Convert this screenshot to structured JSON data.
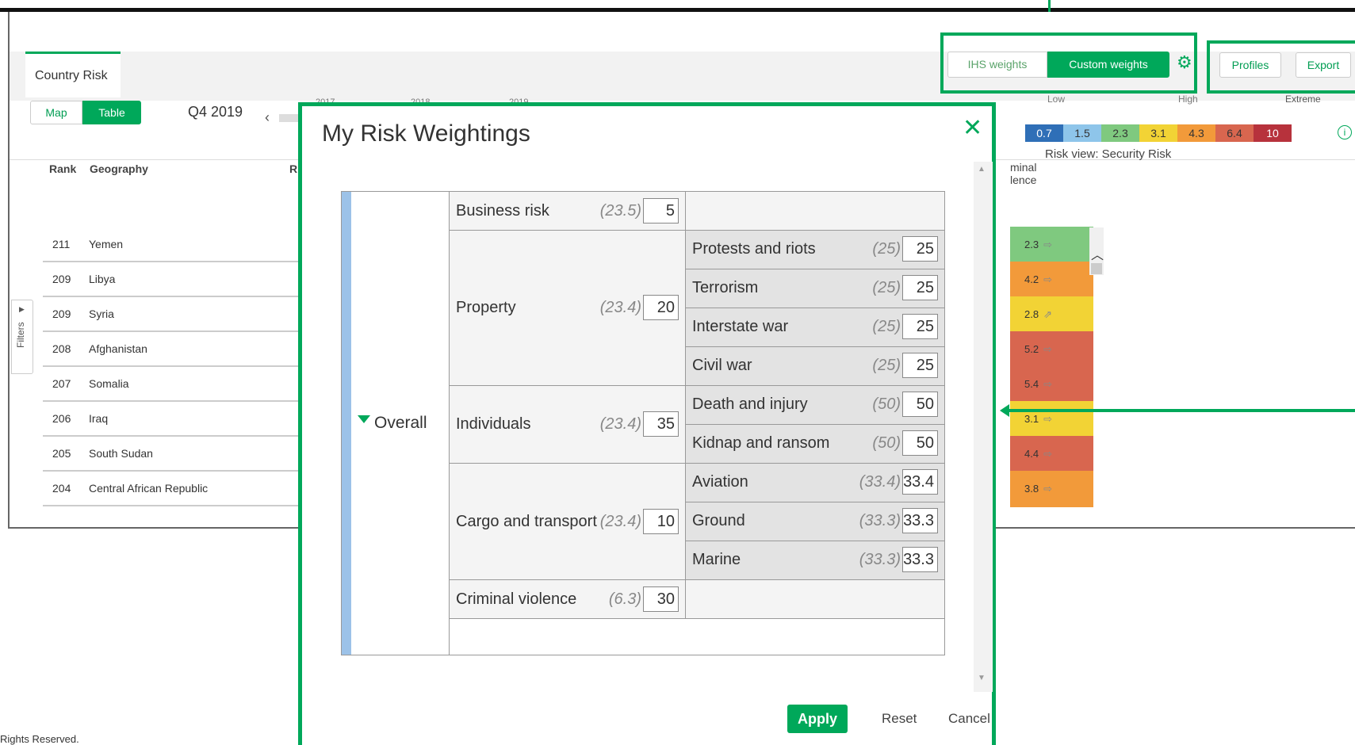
{
  "app": {
    "tab": "Country Risk",
    "view_toggle": [
      "Map",
      "Table"
    ],
    "period": "Q4 2019",
    "years": [
      "2017",
      "2018",
      "2019"
    ],
    "weights_toggle": [
      "IHS weights",
      "Custom weights"
    ],
    "profiles": "Profiles",
    "export": "Export",
    "legend": {
      "labels": [
        "Low",
        "High",
        "Extreme"
      ],
      "values": [
        "0.7",
        "1.5",
        "2.3",
        "3.1",
        "4.3",
        "6.4",
        "10"
      ],
      "colors": [
        "#2f6fb7",
        "#8ec5ea",
        "#7fc97f",
        "#f2d335",
        "#f29a3a",
        "#d8664f",
        "#b7323c"
      ]
    },
    "risk_view": "Risk view: Security Risk",
    "columns": {
      "rank": "Rank",
      "geography": "Geography",
      "extra": "Ri",
      "criminal": "minal\nlence"
    },
    "rows": [
      {
        "rank": "211",
        "geo": "Yemen",
        "score": "2.3",
        "trend": "⇨",
        "color": "#7fc97f"
      },
      {
        "rank": "209",
        "geo": "Libya",
        "score": "4.2",
        "trend": "⇨",
        "color": "#f29a3a"
      },
      {
        "rank": "209",
        "geo": "Syria",
        "score": "2.8",
        "trend": "⇗",
        "color": "#f2d335"
      },
      {
        "rank": "208",
        "geo": "Afghanistan",
        "score": "5.2",
        "trend": "⇨",
        "color": "#d8664f"
      },
      {
        "rank": "207",
        "geo": "Somalia",
        "score": "5.4",
        "trend": "⇨",
        "color": "#d8664f"
      },
      {
        "rank": "206",
        "geo": "Iraq",
        "score": "3.1",
        "trend": "⇨",
        "color": "#f2d335"
      },
      {
        "rank": "205",
        "geo": "South Sudan",
        "score": "4.4",
        "trend": "⇨",
        "color": "#d8664f"
      },
      {
        "rank": "204",
        "geo": "Central African Republic",
        "score": "3.8",
        "trend": "⇨",
        "color": "#f29a3a"
      }
    ],
    "filters": "Filters",
    "footer": "Rights Reserved."
  },
  "modal": {
    "title": "My Risk Weightings",
    "overall": "Overall",
    "categories": [
      {
        "label": "Business risk",
        "default": "(23.5)",
        "value": "5",
        "subs": []
      },
      {
        "label": "Property",
        "default": "(23.4)",
        "value": "20",
        "subs": [
          {
            "label": "Protests and riots",
            "default": "(25)",
            "value": "25"
          },
          {
            "label": "Terrorism",
            "default": "(25)",
            "value": "25"
          },
          {
            "label": "Interstate war",
            "default": "(25)",
            "value": "25"
          },
          {
            "label": "Civil war",
            "default": "(25)",
            "value": "25"
          }
        ]
      },
      {
        "label": "Individuals",
        "default": "(23.4)",
        "value": "35",
        "subs": [
          {
            "label": "Death and injury",
            "default": "(50)",
            "value": "50"
          },
          {
            "label": "Kidnap and ransom",
            "default": "(50)",
            "value": "50"
          }
        ]
      },
      {
        "label": "Cargo and transport",
        "default": "(23.4)",
        "value": "10",
        "subs": [
          {
            "label": "Aviation",
            "default": "(33.4)",
            "value": "33.4"
          },
          {
            "label": "Ground",
            "default": "(33.3)",
            "value": "33.3"
          },
          {
            "label": "Marine",
            "default": "(33.3)",
            "value": "33.3"
          }
        ]
      },
      {
        "label": "Criminal violence",
        "default": "(6.3)",
        "value": "30",
        "subs": []
      }
    ],
    "apply": "Apply",
    "reset": "Reset",
    "cancel": "Cancel"
  }
}
